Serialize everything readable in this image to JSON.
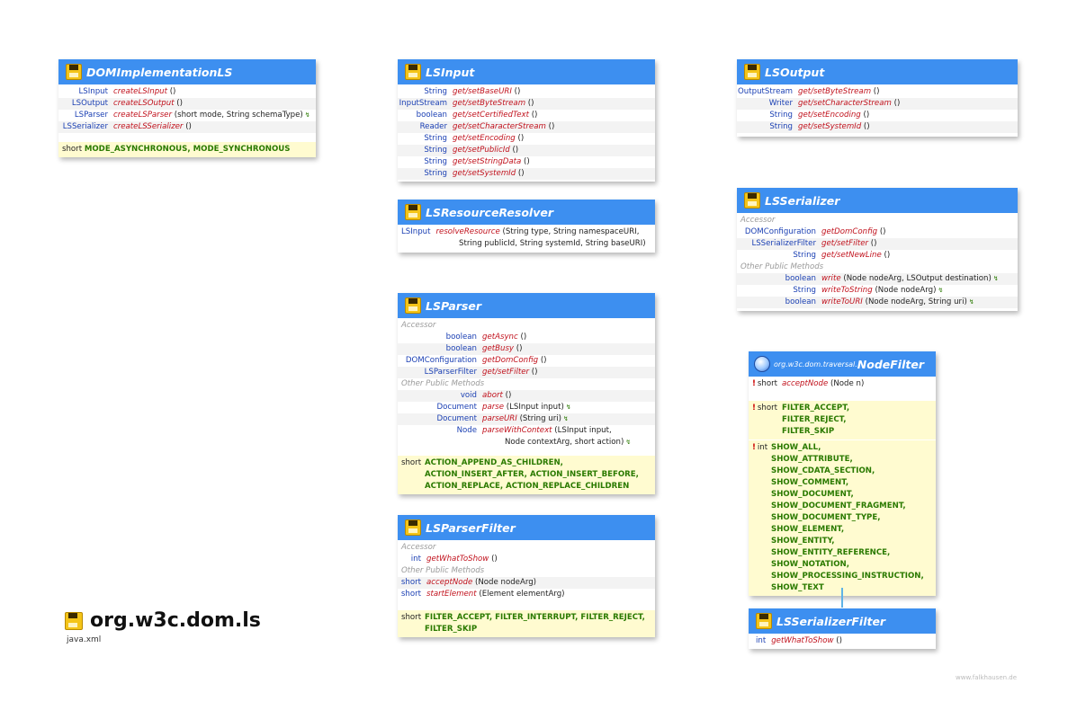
{
  "package": {
    "title": "org.w3c.dom.ls",
    "module": "java.xml",
    "credit": "www.falkhausen.de"
  },
  "colors": {
    "header": "#3d8ff0",
    "type": "#1a3fb3",
    "method": "#c1121d",
    "constant": "#2a7a00",
    "const_bg": "#fffbd0"
  },
  "dom_impl": {
    "title": "DOMImplementationLS",
    "rows": [
      {
        "type": "LSInput",
        "method": "createLSInput",
        "params": "()"
      },
      {
        "type": "LSOutput",
        "method": "createLSOutput",
        "params": "()"
      },
      {
        "type": "LSParser",
        "method": "createLSParser",
        "params": "(short mode, String schemaType)",
        "arrow": "↯"
      },
      {
        "type": "LSSerializer",
        "method": "createLSSerializer",
        "params": "()"
      }
    ],
    "const_type": "short",
    "const_names": "MODE_ASYNCHRONOUS, MODE_SYNCHRONOUS"
  },
  "lsinput": {
    "title": "LSInput",
    "rows": [
      {
        "type": "String",
        "method": "get/setBaseURI",
        "params": "()"
      },
      {
        "type": "InputStream",
        "method": "get/setByteStream",
        "params": "()"
      },
      {
        "type": "boolean",
        "method": "get/setCertifiedText",
        "params": "()"
      },
      {
        "type": "Reader",
        "method": "get/setCharacterStream",
        "params": "()"
      },
      {
        "type": "String",
        "method": "get/setEncoding",
        "params": "()"
      },
      {
        "type": "String",
        "method": "get/setPublicId",
        "params": "()"
      },
      {
        "type": "String",
        "method": "get/setStringData",
        "params": "()"
      },
      {
        "type": "String",
        "method": "get/setSystemId",
        "params": "()"
      }
    ]
  },
  "lsoutput": {
    "title": "LSOutput",
    "rows": [
      {
        "type": "OutputStream",
        "method": "get/setByteStream",
        "params": "()"
      },
      {
        "type": "Writer",
        "method": "get/setCharacterStream",
        "params": "()"
      },
      {
        "type": "String",
        "method": "get/setEncoding",
        "params": "()"
      },
      {
        "type": "String",
        "method": "get/setSystemId",
        "params": "()"
      }
    ]
  },
  "resolver": {
    "title": "LSResourceResolver",
    "type": "LSInput",
    "method": "resolveResource",
    "line1": "(String type, String namespaceURI,",
    "line2": "String publicId, String systemId, String baseURI)"
  },
  "serializer": {
    "title": "LSSerializer",
    "sec1": "Accessor",
    "acc": [
      {
        "type": "DOMConfiguration",
        "method": "getDomConfig",
        "params": "()"
      },
      {
        "type": "LSSerializerFilter",
        "method": "get/setFilter",
        "params": "()"
      },
      {
        "type": "String",
        "method": "get/setNewLine",
        "params": "()"
      }
    ],
    "sec2": "Other Public Methods",
    "other": [
      {
        "type": "boolean",
        "method": "write",
        "params": "(Node nodeArg, LSOutput destination)",
        "arrow": "↯"
      },
      {
        "type": "String",
        "method": "writeToString",
        "params": "(Node nodeArg)",
        "arrow": "↯"
      },
      {
        "type": "boolean",
        "method": "writeToURI",
        "params": "(Node nodeArg, String uri)",
        "arrow": "↯"
      }
    ]
  },
  "parser": {
    "title": "LSParser",
    "sec1": "Accessor",
    "acc": [
      {
        "type": "boolean",
        "method": "getAsync",
        "params": "()"
      },
      {
        "type": "boolean",
        "method": "getBusy",
        "params": "()"
      },
      {
        "type": "DOMConfiguration",
        "method": "getDomConfig",
        "params": "()"
      },
      {
        "type": "LSParserFilter",
        "method": "get/setFilter",
        "params": "()"
      }
    ],
    "sec2": "Other Public Methods",
    "other": [
      {
        "type": "void",
        "method": "abort",
        "params": "()"
      },
      {
        "type": "Document",
        "method": "parse",
        "params": "(LSInput input)",
        "arrow": "↯"
      },
      {
        "type": "Document",
        "method": "parseURI",
        "params": "(String uri)",
        "arrow": "↯"
      },
      {
        "type": "Node",
        "method": "parseWithContext",
        "params": "(LSInput input,"
      }
    ],
    "cont": "Node contextArg, short action)",
    "cont_arrow": "↯",
    "const_type": "short",
    "const_lines": [
      "ACTION_APPEND_AS_CHILDREN,",
      "ACTION_INSERT_AFTER, ACTION_INSERT_BEFORE,",
      "ACTION_REPLACE, ACTION_REPLACE_CHILDREN"
    ]
  },
  "parser_filter": {
    "title": "LSParserFilter",
    "sec1": "Accessor",
    "acc": [
      {
        "type": "int",
        "method": "getWhatToShow",
        "params": "()"
      }
    ],
    "sec2": "Other Public Methods",
    "other": [
      {
        "type": "short",
        "method": "acceptNode",
        "params": "(Node nodeArg)"
      },
      {
        "type": "short",
        "method": "startElement",
        "params": "(Element elementArg)"
      }
    ],
    "const_type": "short",
    "const_lines": [
      "FILTER_ACCEPT, FILTER_INTERRUPT, FILTER_REJECT,",
      "FILTER_SKIP"
    ]
  },
  "node_filter": {
    "pkg": "org.w3c.dom.traversal.",
    "title": "NodeFilter",
    "row": {
      "mark": "!",
      "type": "short",
      "method": "acceptNode",
      "params": "(Node n)"
    },
    "const1_mark": "!",
    "const1_type": "short",
    "const1_lines": [
      "FILTER_ACCEPT,",
      "FILTER_REJECT,",
      "FILTER_SKIP"
    ],
    "const2_mark": "!",
    "const2_type": "int",
    "const2_lines": [
      "SHOW_ALL,",
      "SHOW_ATTRIBUTE,",
      "SHOW_CDATA_SECTION,",
      "SHOW_COMMENT,",
      "SHOW_DOCUMENT,",
      "SHOW_DOCUMENT_FRAGMENT,",
      "SHOW_DOCUMENT_TYPE,",
      "SHOW_ELEMENT,",
      "SHOW_ENTITY,",
      "SHOW_ENTITY_REFERENCE,",
      "SHOW_NOTATION,",
      "SHOW_PROCESSING_INSTRUCTION,",
      "SHOW_TEXT"
    ]
  },
  "serializer_filter": {
    "title": "LSSerializerFilter",
    "row": {
      "type": "int",
      "method": "getWhatToShow",
      "params": "()"
    }
  }
}
